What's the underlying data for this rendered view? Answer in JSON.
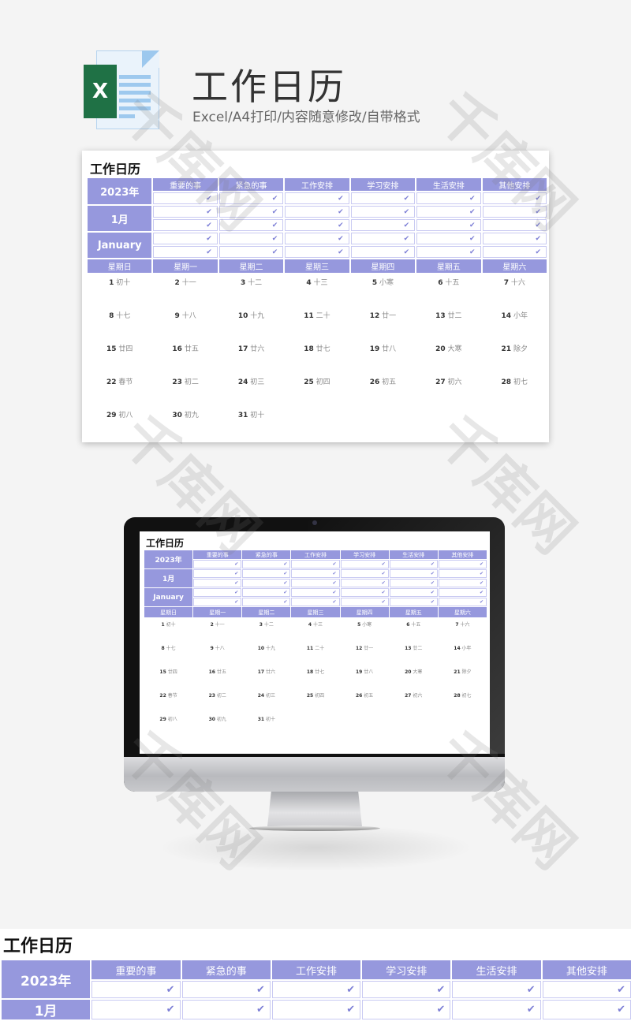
{
  "header": {
    "icon": "excel-file-icon",
    "icon_letter": "X",
    "title": "工作日历",
    "subtitle": "Excel/A4打印/内容随意修改/自带格式"
  },
  "sheet": {
    "title": "工作日历",
    "year": "2023年",
    "month": "1月",
    "month_en": "January",
    "colors": {
      "header_bg": "#9698dd",
      "check": "#7d7fd6",
      "cell_border": "#c9caf2"
    },
    "categories": [
      "重要的事",
      "紧急的事",
      "工作安排",
      "学习安排",
      "生活安排",
      "其他安排"
    ],
    "check_mark": "✔",
    "task_rows": 5,
    "weekdays": [
      "星期日",
      "星期一",
      "星期二",
      "星期三",
      "星期四",
      "星期五",
      "星期六"
    ],
    "weeks": [
      [
        {
          "d": "1",
          "l": "初十"
        },
        {
          "d": "2",
          "l": "十一"
        },
        {
          "d": "3",
          "l": "十二"
        },
        {
          "d": "4",
          "l": "十三"
        },
        {
          "d": "5",
          "l": "小寒"
        },
        {
          "d": "6",
          "l": "十五"
        },
        {
          "d": "7",
          "l": "十六"
        }
      ],
      [
        {
          "d": "8",
          "l": "十七"
        },
        {
          "d": "9",
          "l": "十八"
        },
        {
          "d": "10",
          "l": "十九"
        },
        {
          "d": "11",
          "l": "二十"
        },
        {
          "d": "12",
          "l": "廿一"
        },
        {
          "d": "13",
          "l": "廿二"
        },
        {
          "d": "14",
          "l": "小年"
        }
      ],
      [
        {
          "d": "15",
          "l": "廿四"
        },
        {
          "d": "16",
          "l": "廿五"
        },
        {
          "d": "17",
          "l": "廿六"
        },
        {
          "d": "18",
          "l": "廿七"
        },
        {
          "d": "19",
          "l": "廿八"
        },
        {
          "d": "20",
          "l": "大寒"
        },
        {
          "d": "21",
          "l": "除夕"
        }
      ],
      [
        {
          "d": "22",
          "l": "春节"
        },
        {
          "d": "23",
          "l": "初二"
        },
        {
          "d": "24",
          "l": "初三"
        },
        {
          "d": "25",
          "l": "初四"
        },
        {
          "d": "26",
          "l": "初五"
        },
        {
          "d": "27",
          "l": "初六"
        },
        {
          "d": "28",
          "l": "初七"
        }
      ],
      [
        {
          "d": "29",
          "l": "初八"
        },
        {
          "d": "30",
          "l": "初九"
        },
        {
          "d": "31",
          "l": "初十"
        },
        {
          "d": "",
          "l": ""
        },
        {
          "d": "",
          "l": ""
        },
        {
          "d": "",
          "l": ""
        },
        {
          "d": "",
          "l": ""
        }
      ]
    ]
  },
  "watermark": "千库网"
}
